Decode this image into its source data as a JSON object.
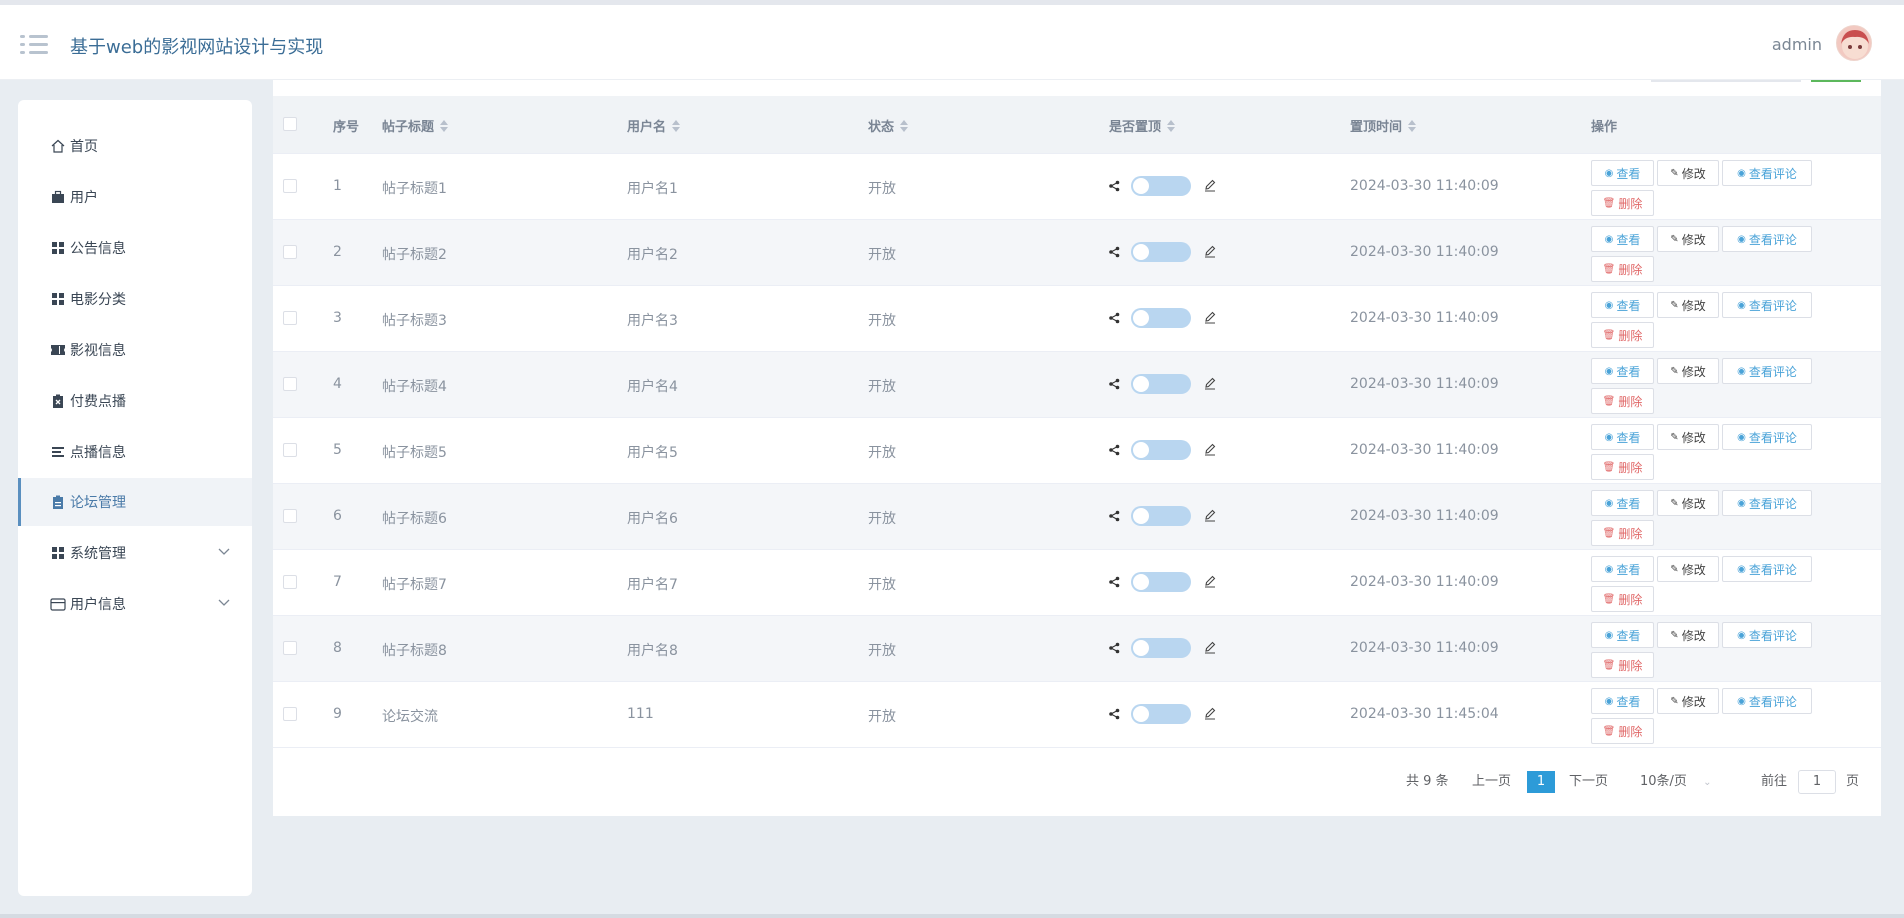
{
  "app": {
    "title": "基于web的影视网站设计与实现",
    "user": "admin"
  },
  "sidebar": {
    "items": [
      {
        "label": "首页",
        "icon": "home-icon"
      },
      {
        "label": "用户",
        "icon": "briefcase-icon"
      },
      {
        "label": "公告信息",
        "icon": "grid-icon"
      },
      {
        "label": "电影分类",
        "icon": "grid-icon"
      },
      {
        "label": "影视信息",
        "icon": "ticket-icon"
      },
      {
        "label": "付费点播",
        "icon": "clipboard-x-icon"
      },
      {
        "label": "点播信息",
        "icon": "list-icon"
      },
      {
        "label": "论坛管理",
        "icon": "clipboard-icon",
        "active": true
      },
      {
        "label": "系统管理",
        "icon": "grid-icon",
        "expandable": true
      },
      {
        "label": "用户信息",
        "icon": "card-icon",
        "expandable": true
      }
    ]
  },
  "table": {
    "headers": {
      "index": "序号",
      "title": "帖子标题",
      "username": "用户名",
      "status": "状态",
      "top": "是否置顶",
      "toptime": "置顶时间",
      "actions": "操作"
    },
    "rows": [
      {
        "index": "1",
        "title": "帖子标题1",
        "username": "用户名1",
        "status": "开放",
        "toptime": "2024-03-30 11:40:09"
      },
      {
        "index": "2",
        "title": "帖子标题2",
        "username": "用户名2",
        "status": "开放",
        "toptime": "2024-03-30 11:40:09"
      },
      {
        "index": "3",
        "title": "帖子标题3",
        "username": "用户名3",
        "status": "开放",
        "toptime": "2024-03-30 11:40:09"
      },
      {
        "index": "4",
        "title": "帖子标题4",
        "username": "用户名4",
        "status": "开放",
        "toptime": "2024-03-30 11:40:09"
      },
      {
        "index": "5",
        "title": "帖子标题5",
        "username": "用户名5",
        "status": "开放",
        "toptime": "2024-03-30 11:40:09"
      },
      {
        "index": "6",
        "title": "帖子标题6",
        "username": "用户名6",
        "status": "开放",
        "toptime": "2024-03-30 11:40:09"
      },
      {
        "index": "7",
        "title": "帖子标题7",
        "username": "用户名7",
        "status": "开放",
        "toptime": "2024-03-30 11:40:09"
      },
      {
        "index": "8",
        "title": "帖子标题8",
        "username": "用户名8",
        "status": "开放",
        "toptime": "2024-03-30 11:40:09"
      },
      {
        "index": "9",
        "title": "论坛交流",
        "username": "111",
        "status": "开放",
        "toptime": "2024-03-30 11:45:04"
      }
    ],
    "actions": {
      "view": "查看",
      "edit": "修改",
      "comments": "查看评论",
      "delete": "删除"
    }
  },
  "pagination": {
    "total": "共 9 条",
    "prev": "上一页",
    "current": "1",
    "next": "下一页",
    "page_size": "10条/页",
    "goto": "前往",
    "goto_value": "1",
    "page_unit": "页"
  },
  "colors": {
    "accent": "#2d9bd8",
    "delete": "#e06666",
    "switch": "#b9d6f0"
  }
}
